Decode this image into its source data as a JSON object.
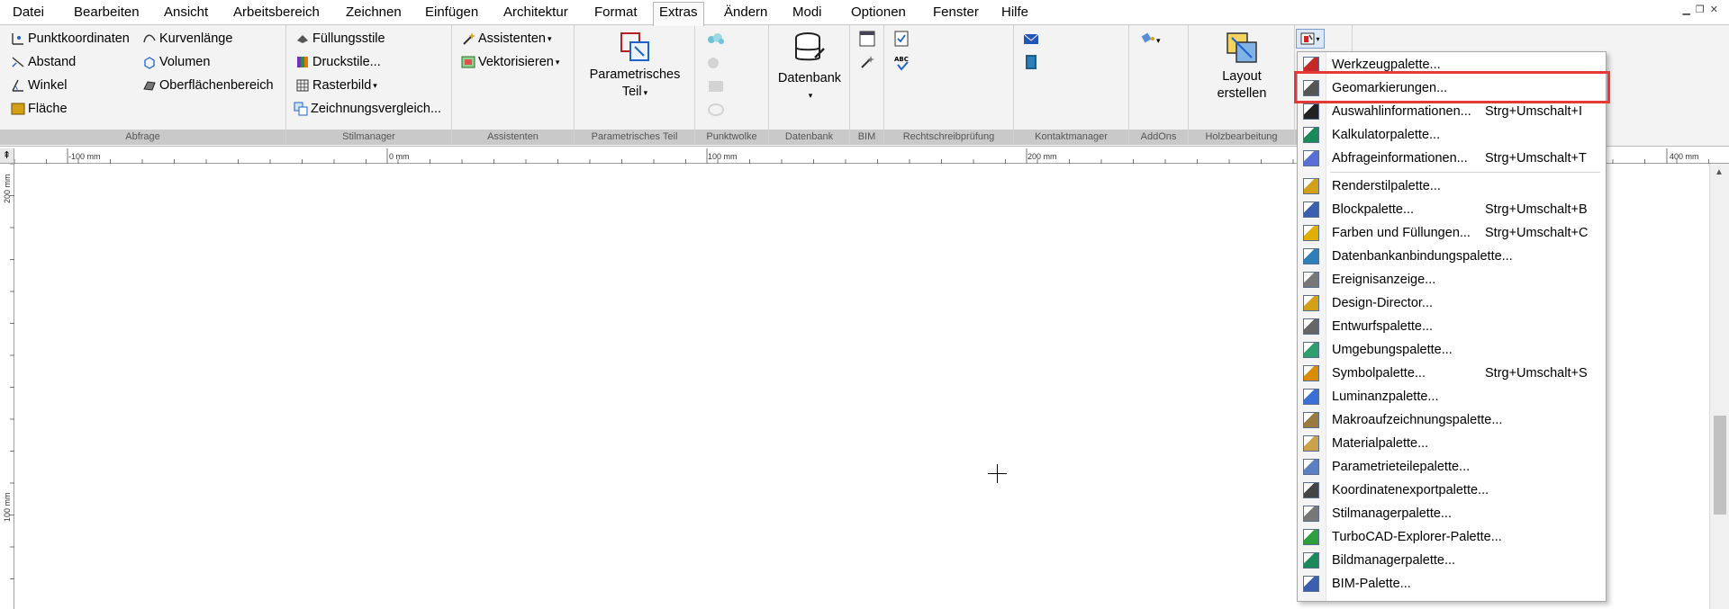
{
  "menubar": {
    "items": [
      "Datei",
      "Bearbeiten",
      "Ansicht",
      "Arbeitsbereich",
      "Zeichnen",
      "Einfügen",
      "Architektur",
      "Format",
      "Extras",
      "Ändern",
      "Modi",
      "Optionen",
      "Fenster",
      "Hilfe"
    ],
    "active": "Extras"
  },
  "ribbon": {
    "abfrage": {
      "label": "Abfrage",
      "left": [
        "Punktkoordinaten",
        "Abstand",
        "Winkel",
        "Fläche"
      ],
      "right": [
        "Kurvenlänge",
        "Volumen",
        "Oberflächenbereich"
      ]
    },
    "stilmanager": {
      "label": "Stilmanager",
      "items": [
        "Füllungsstile",
        "Druckstile...",
        "Rasterbild",
        "Zeichnungsvergleich..."
      ]
    },
    "assistenten": {
      "label": "Assistenten",
      "items": [
        "Assistenten",
        "Vektorisieren"
      ]
    },
    "parametrisch": {
      "label": "Parametrisches Teil",
      "line1": "Parametrisches",
      "line2": "Teil"
    },
    "punktwolke": {
      "label": "Punktwolke"
    },
    "datenbank": {
      "label": "Datenbank",
      "button": "Datenbank"
    },
    "bim": {
      "label": "BIM"
    },
    "rechtschreib": {
      "label": "Rechtschreibprüfung"
    },
    "kontakt": {
      "label": "Kontaktmanager"
    },
    "addons": {
      "label": "AddOns"
    },
    "holz": {
      "label": "Holzbearbeitung",
      "line1": "Layout",
      "line2": "erstellen"
    }
  },
  "rulers": {
    "horizontal": [
      "-100 mm",
      "0 mm",
      "100 mm",
      "200 mm",
      "400 mm"
    ],
    "vertical": [
      "200 mm",
      "100 mm"
    ]
  },
  "dropdown": {
    "items": [
      {
        "label": "Werkzeugpalette...",
        "shortcut": ""
      },
      {
        "label": "Geomarkierungen...",
        "shortcut": ""
      },
      {
        "label": "Auswahlinformationen...",
        "shortcut": "Strg+Umschalt+I"
      },
      {
        "label": "Kalkulatorpalette...",
        "shortcut": ""
      },
      {
        "label": "Abfrageinformationen...",
        "shortcut": "Strg+Umschalt+T"
      },
      {
        "label": "Renderstilpalette...",
        "shortcut": ""
      },
      {
        "label": "Blockpalette...",
        "shortcut": "Strg+Umschalt+B"
      },
      {
        "label": "Farben und Füllungen...",
        "shortcut": "Strg+Umschalt+C"
      },
      {
        "label": "Datenbankanbindungspalette...",
        "shortcut": ""
      },
      {
        "label": "Ereignisanzeige...",
        "shortcut": ""
      },
      {
        "label": "Design-Director...",
        "shortcut": ""
      },
      {
        "label": "Entwurfspalette...",
        "shortcut": ""
      },
      {
        "label": "Umgebungspalette...",
        "shortcut": ""
      },
      {
        "label": "Symbolpalette...",
        "shortcut": "Strg+Umschalt+S"
      },
      {
        "label": "Luminanzpalette...",
        "shortcut": ""
      },
      {
        "label": "Makroaufzeichnungspalette...",
        "shortcut": ""
      },
      {
        "label": "Materialpalette...",
        "shortcut": ""
      },
      {
        "label": "Parametrieteilepalette...",
        "shortcut": ""
      },
      {
        "label": "Koordinatenexportpalette...",
        "shortcut": ""
      },
      {
        "label": "Stilmanagerpalette...",
        "shortcut": ""
      },
      {
        "label": "TurboCAD-Explorer-Palette...",
        "shortcut": ""
      },
      {
        "label": "Bildmanagerpalette...",
        "shortcut": ""
      },
      {
        "label": "BIM-Palette...",
        "shortcut": ""
      }
    ]
  },
  "colors": {
    "highlight_border": "#e53935",
    "ribbon_bg": "#f3f3f3",
    "group_label_bg": "#c9c9c9"
  }
}
